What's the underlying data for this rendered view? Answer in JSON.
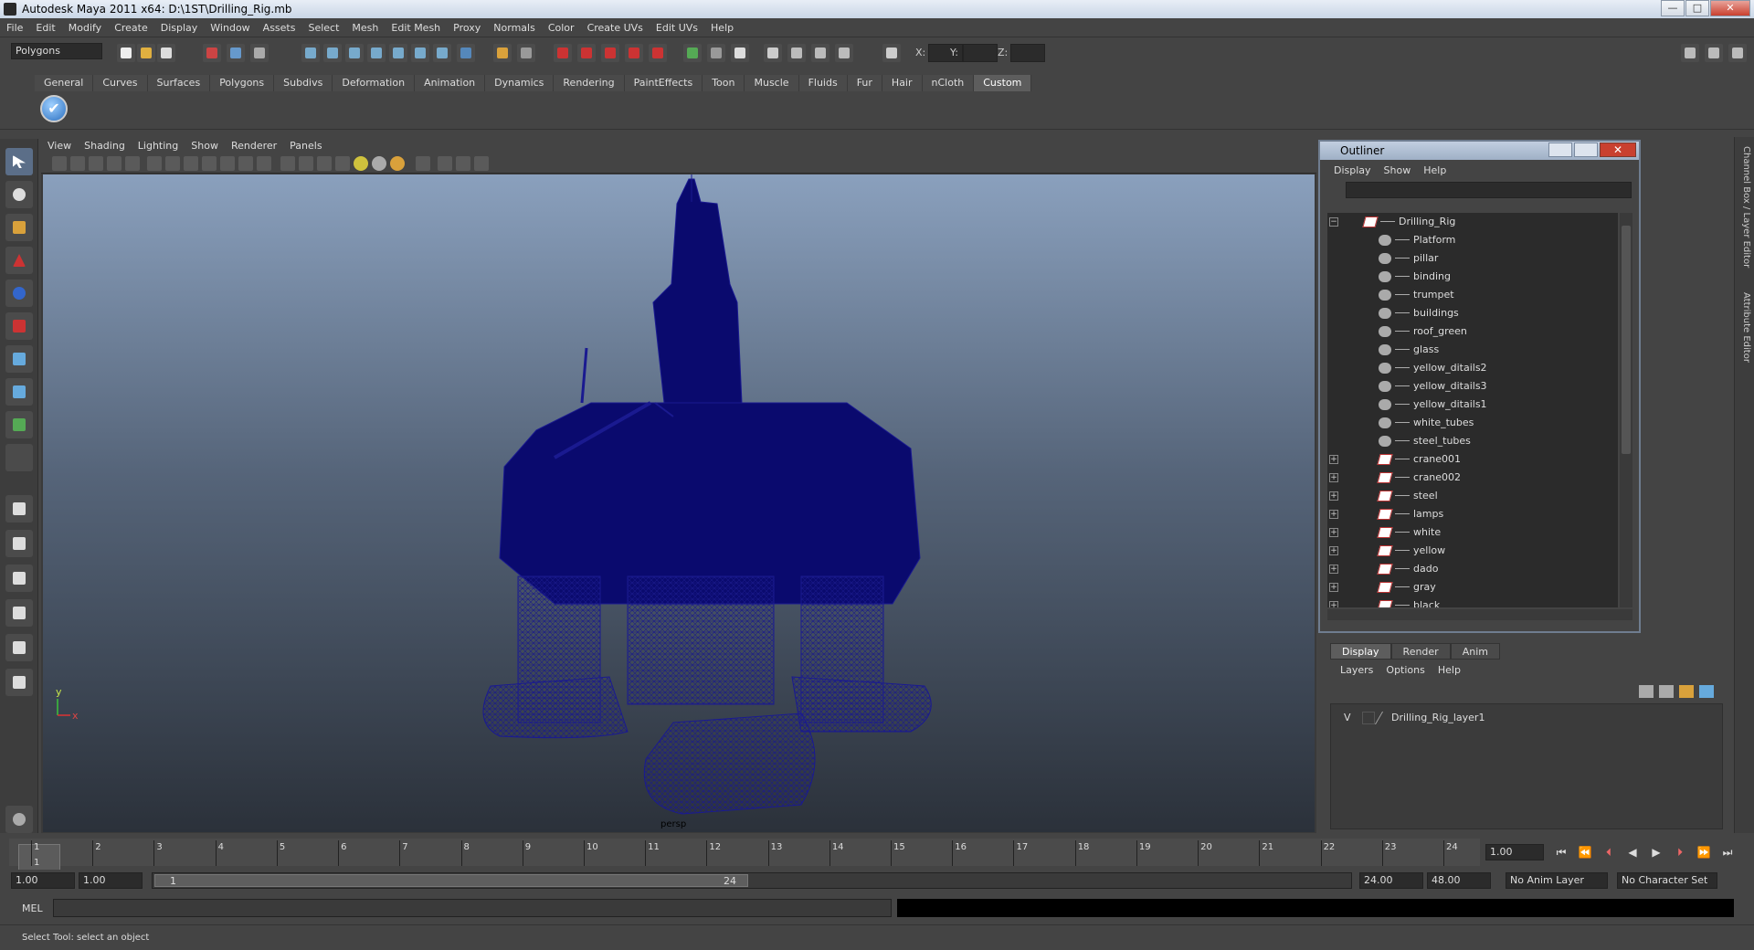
{
  "window": {
    "title": "Autodesk Maya 2011 x64: D:\\1ST\\Drilling_Rig.mb"
  },
  "menu": [
    "File",
    "Edit",
    "Modify",
    "Create",
    "Display",
    "Window",
    "Assets",
    "Select",
    "Mesh",
    "Edit Mesh",
    "Proxy",
    "Normals",
    "Color",
    "Create UVs",
    "Edit UVs",
    "Help"
  ],
  "status_line": {
    "mode": "Polygons",
    "x_label": "X:",
    "y_label": "Y:",
    "z_label": "Z:"
  },
  "shelf_tabs": [
    "General",
    "Curves",
    "Surfaces",
    "Polygons",
    "Subdivs",
    "Deformation",
    "Animation",
    "Dynamics",
    "Rendering",
    "PaintEffects",
    "Toon",
    "Muscle",
    "Fluids",
    "Fur",
    "Hair",
    "nCloth",
    "Custom"
  ],
  "shelf_active": "Custom",
  "viewport": {
    "menu": [
      "View",
      "Shading",
      "Lighting",
      "Show",
      "Renderer",
      "Panels"
    ],
    "camera_label": "persp",
    "axis_x": "x",
    "axis_y": "y"
  },
  "outliner": {
    "title": "Outliner",
    "menu": [
      "Display",
      "Show",
      "Help"
    ],
    "items": [
      {
        "label": "Drilling_Rig",
        "type": "group",
        "expander": "−",
        "depth": 0
      },
      {
        "label": "Platform",
        "type": "mesh",
        "expander": "",
        "depth": 1
      },
      {
        "label": "pillar",
        "type": "mesh",
        "expander": "",
        "depth": 1
      },
      {
        "label": "binding",
        "type": "mesh",
        "expander": "",
        "depth": 1
      },
      {
        "label": "trumpet",
        "type": "mesh",
        "expander": "",
        "depth": 1
      },
      {
        "label": "buildings",
        "type": "mesh",
        "expander": "",
        "depth": 1
      },
      {
        "label": "roof_green",
        "type": "mesh",
        "expander": "",
        "depth": 1
      },
      {
        "label": "glass",
        "type": "mesh",
        "expander": "",
        "depth": 1
      },
      {
        "label": "yellow_ditails2",
        "type": "mesh",
        "expander": "",
        "depth": 1
      },
      {
        "label": "yellow_ditails3",
        "type": "mesh",
        "expander": "",
        "depth": 1
      },
      {
        "label": "yellow_ditails1",
        "type": "mesh",
        "expander": "",
        "depth": 1
      },
      {
        "label": "white_tubes",
        "type": "mesh",
        "expander": "",
        "depth": 1
      },
      {
        "label": "steel_tubes",
        "type": "mesh",
        "expander": "",
        "depth": 1
      },
      {
        "label": "crane001",
        "type": "group",
        "expander": "+",
        "depth": 1
      },
      {
        "label": "crane002",
        "type": "group",
        "expander": "+",
        "depth": 1
      },
      {
        "label": "steel",
        "type": "group",
        "expander": "+",
        "depth": 1
      },
      {
        "label": "lamps",
        "type": "group",
        "expander": "+",
        "depth": 1
      },
      {
        "label": "white",
        "type": "group",
        "expander": "+",
        "depth": 1
      },
      {
        "label": "yellow",
        "type": "group",
        "expander": "+",
        "depth": 1
      },
      {
        "label": "dado",
        "type": "group",
        "expander": "+",
        "depth": 1
      },
      {
        "label": "gray",
        "type": "group",
        "expander": "+",
        "depth": 1
      },
      {
        "label": "black",
        "type": "group",
        "expander": "+",
        "depth": 1
      }
    ]
  },
  "layer_editor": {
    "tabs": [
      "Display",
      "Render",
      "Anim"
    ],
    "active_tab": "Display",
    "menu": [
      "Layers",
      "Options",
      "Help"
    ],
    "layers": [
      {
        "visible": "V",
        "name": "Drilling_Rig_layer1"
      }
    ]
  },
  "side_tabs": [
    "Channel Box / Layer Editor",
    "Attribute Editor"
  ],
  "timeline": {
    "frames": [
      "1",
      "2",
      "3",
      "4",
      "5",
      "6",
      "7",
      "8",
      "9",
      "10",
      "11",
      "12",
      "13",
      "14",
      "15",
      "16",
      "17",
      "18",
      "19",
      "20",
      "21",
      "22",
      "23",
      "24"
    ],
    "current_frame": "1",
    "current_time_field": "1.00"
  },
  "range": {
    "start_time": "1.00",
    "playback_start": "1.00",
    "slider_start": "1",
    "slider_end": "24",
    "playback_end": "24.00",
    "end_time": "48.00",
    "anim_layer": "No Anim Layer",
    "character_set": "No Character Set"
  },
  "command_line": {
    "label": "MEL"
  },
  "help_line": "Select Tool: select an object",
  "colors": {
    "wireframe": "#0a0a6e",
    "viewport_top": "#8aa0bd",
    "viewport_bottom": "#2b313a",
    "panel": "#444444"
  }
}
